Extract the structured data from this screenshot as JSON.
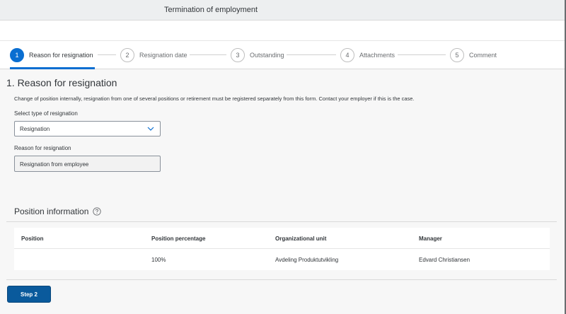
{
  "header": {
    "title": "Termination of employment"
  },
  "wizard": {
    "steps": [
      {
        "number": "1",
        "label": "Reason for resignation"
      },
      {
        "number": "2",
        "label": "Resignation date"
      },
      {
        "number": "3",
        "label": "Outstanding"
      },
      {
        "number": "4",
        "label": "Attachments"
      },
      {
        "number": "5",
        "label": "Comment"
      }
    ],
    "active_step": 1
  },
  "section": {
    "title": "1. Reason for resignation",
    "info": "Change of position internally, resignation from one of several positions or retirement must be registered separately from this form. Contact your employer if this is the case."
  },
  "form": {
    "type_label": "Select type of resignation",
    "type_value": "Resignation",
    "reason_label": "Reason for resignation",
    "reason_value": "Resignation from employee"
  },
  "position": {
    "title": "Position information",
    "columns": [
      "Position",
      "Position percentage",
      "Organizational unit",
      "Manager"
    ],
    "rows": [
      [
        "",
        "100%",
        "Avdeling Produktutvikling",
        "Edvard Christiansen"
      ]
    ]
  },
  "footer": {
    "next_label": "Step 2"
  },
  "colors": {
    "accent": "#0a6ed1",
    "button": "#0a5a9c"
  }
}
